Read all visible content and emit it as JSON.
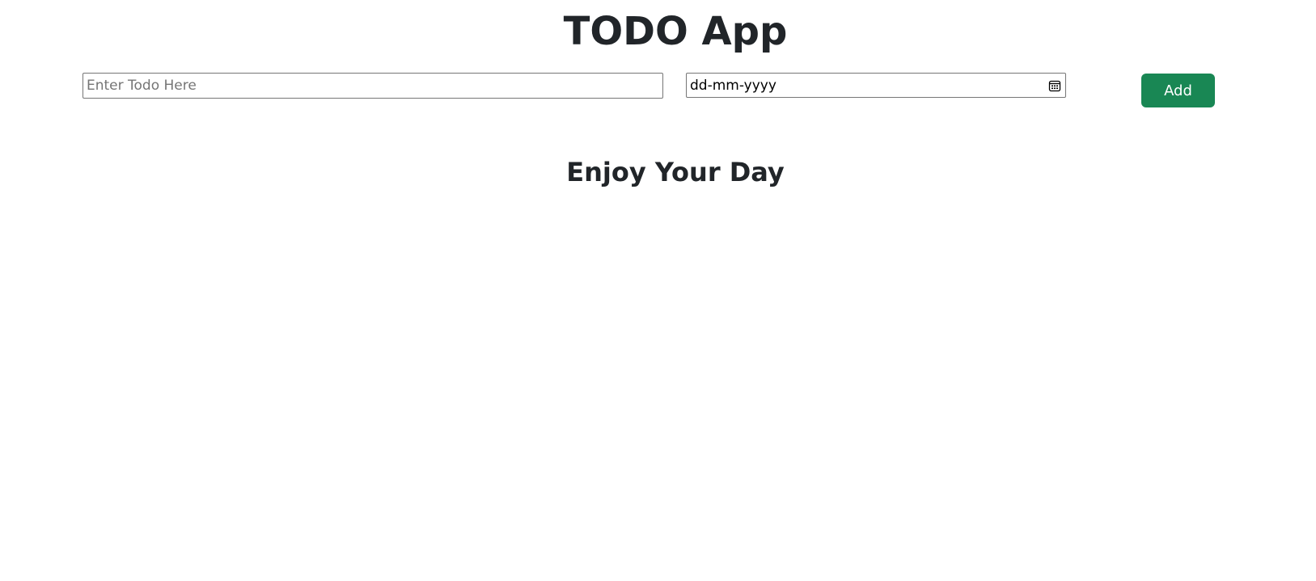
{
  "app": {
    "title": "TODO App"
  },
  "form": {
    "todo_placeholder": "Enter Todo Here",
    "todo_value": "",
    "date_placeholder": "dd-mm-yyyy",
    "date_icon": "calendar-icon",
    "add_label": "Add"
  },
  "main": {
    "message": "Enjoy Your Day"
  },
  "colors": {
    "add_button_bg": "#198754",
    "text": "#212529"
  }
}
